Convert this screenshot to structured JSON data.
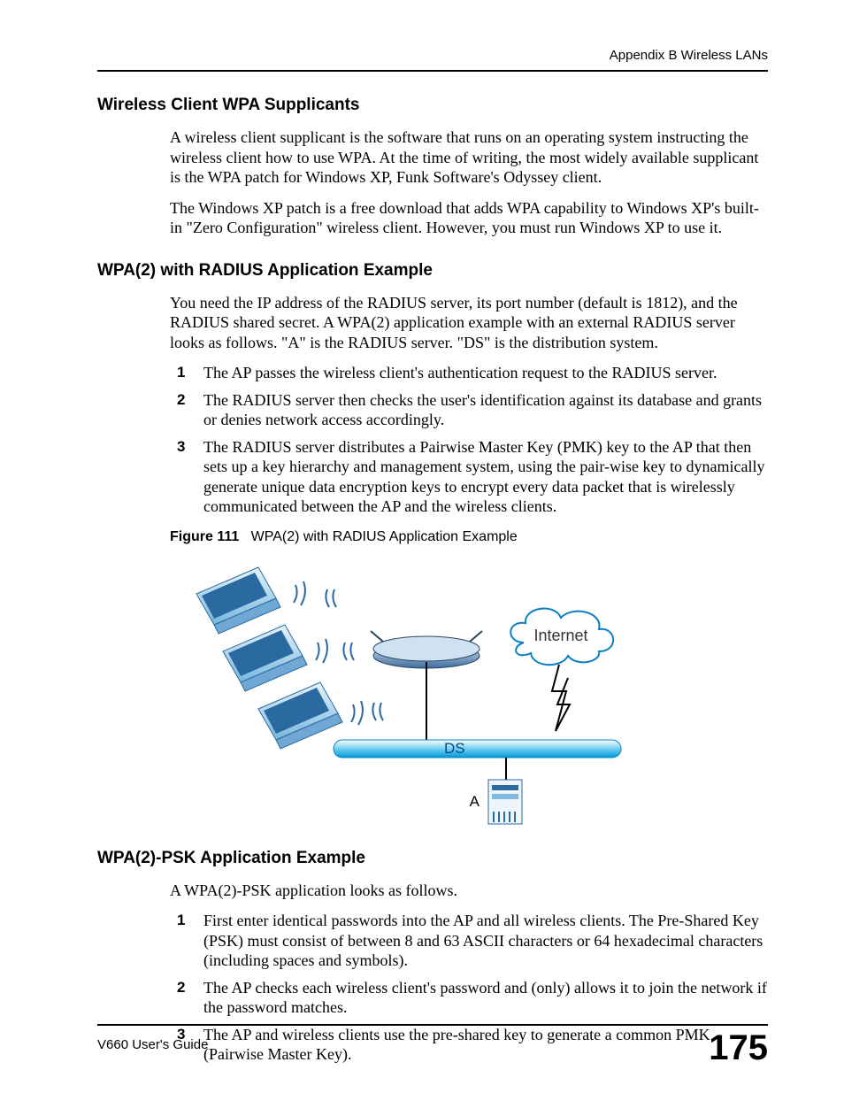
{
  "header": {
    "running": "Appendix B Wireless LANs"
  },
  "sections": {
    "supplicants": {
      "title": "Wireless Client WPA Supplicants",
      "p1": "A wireless client supplicant is the software that runs on an operating system instructing the wireless client how to use WPA. At the time of writing, the most widely available supplicant is the WPA patch for Windows XP, Funk Software's Odyssey client.",
      "p2": "The Windows XP patch is a free download that adds WPA capability to Windows XP's built-in \"Zero Configuration\" wireless client. However, you must run Windows XP to use it."
    },
    "radius": {
      "title": "WPA(2) with RADIUS Application Example",
      "intro": "You need the IP address of the RADIUS server, its port number (default is 1812), and the RADIUS shared secret. A WPA(2) application example with an external RADIUS server looks as follows. \"A\" is the RADIUS server. \"DS\" is the distribution system.",
      "items": [
        "The AP passes the wireless client's authentication request to the RADIUS server.",
        "The RADIUS server then checks the user's identification against its database and grants or denies network access accordingly.",
        "The RADIUS server distributes a Pairwise Master Key (PMK) key to the AP that then sets up a key hierarchy and management system, using the pair-wise key to dynamically generate unique data encryption keys to encrypt every data packet that is wirelessly communicated between the AP and the wireless clients."
      ],
      "figure": {
        "label": "Figure 111",
        "caption": "WPA(2) with RADIUS Application Example",
        "internet": "Internet",
        "ds": "DS",
        "a": "A"
      }
    },
    "psk": {
      "title": "WPA(2)-PSK Application Example",
      "intro": "A WPA(2)-PSK application looks as follows.",
      "items": [
        "First enter identical passwords into the AP and all wireless clients. The Pre-Shared Key (PSK) must consist of between 8 and 63 ASCII characters or 64 hexadecimal characters (including spaces and symbols).",
        "The AP checks each wireless client's password and (only) allows it to join the network if the password matches.",
        "The AP and wireless clients use the pre-shared key to generate a common PMK (Pairwise Master Key)."
      ]
    }
  },
  "footer": {
    "guide": "V660 User's Guide",
    "page": "175"
  }
}
